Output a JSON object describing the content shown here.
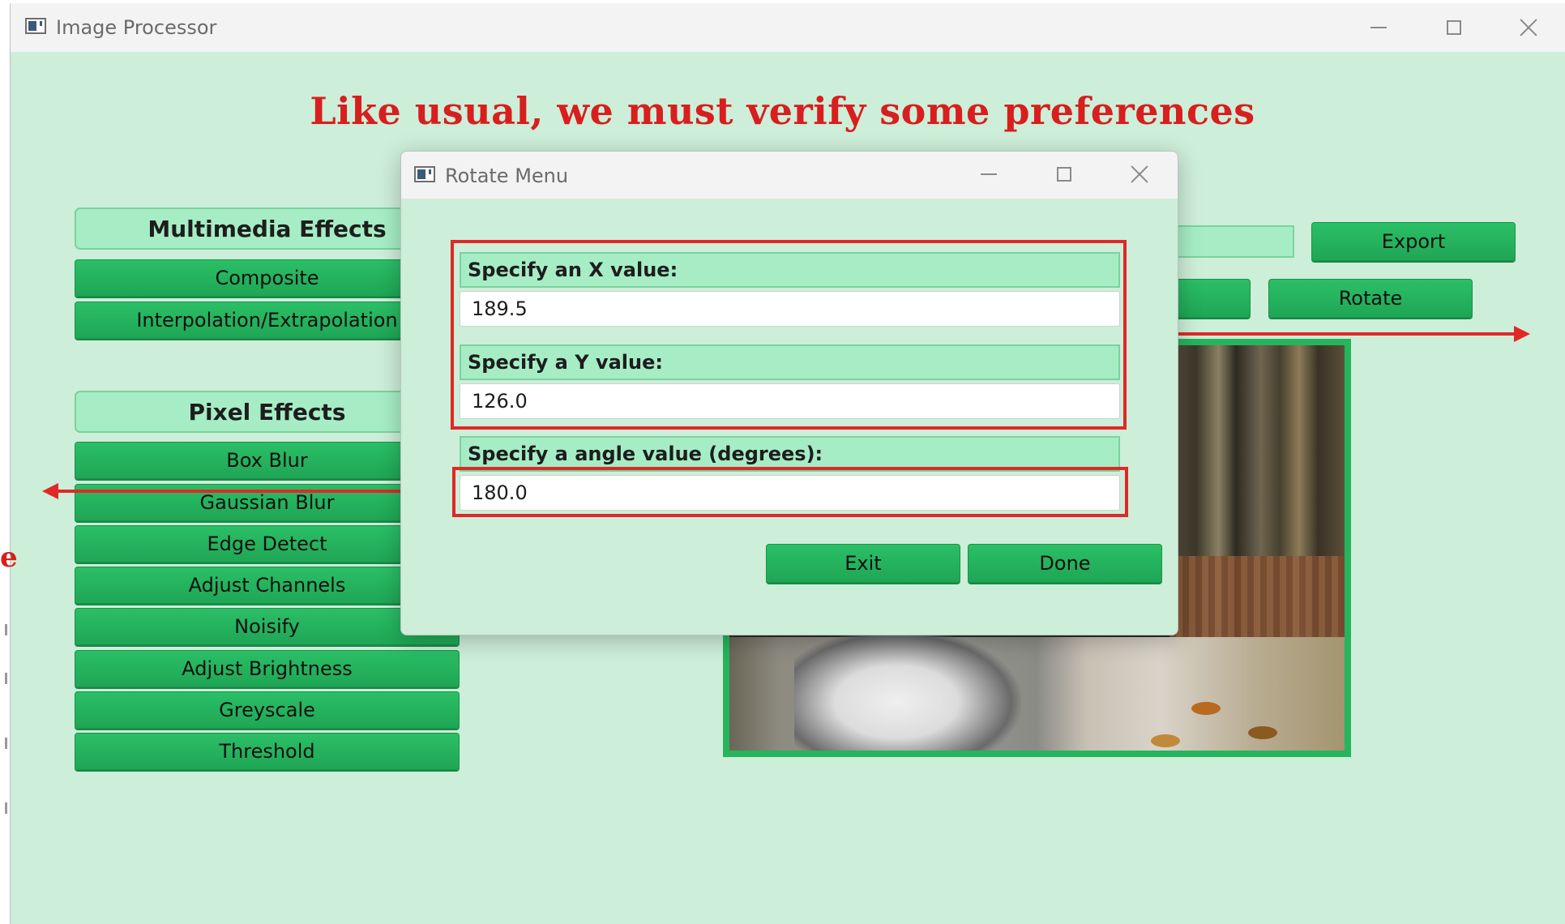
{
  "window": {
    "title": "Image Processor",
    "icon": "app-window-icon"
  },
  "annotation": {
    "headline": "Like usual, we must verify some preferences",
    "edge_letter": "e"
  },
  "multimedia": {
    "header": "Multimedia Effects",
    "buttons": [
      "Composite",
      "Interpolation/Extrapolation"
    ]
  },
  "pixel": {
    "header": "Pixel Effects",
    "buttons": [
      "Box Blur",
      "Gaussian Blur",
      "Edge Detect",
      "Adjust Channels",
      "Noisify",
      "Adjust Brightness",
      "Greyscale",
      "Threshold"
    ]
  },
  "toolbar": {
    "export_label": "Export",
    "rotate_label": "Rotate"
  },
  "dialog": {
    "title": "Rotate Menu",
    "x_label": "Specify an X value:",
    "x_value": "189.5",
    "y_label": "Specify a Y value:",
    "y_value": "126.0",
    "angle_label": "Specify a angle value (degrees):",
    "angle_value": "180.0",
    "exit_label": "Exit",
    "done_label": "Done"
  },
  "colors": {
    "accent_green": "#26b45c",
    "annotation_red": "#d81e1e",
    "background": "#cdeed8"
  }
}
